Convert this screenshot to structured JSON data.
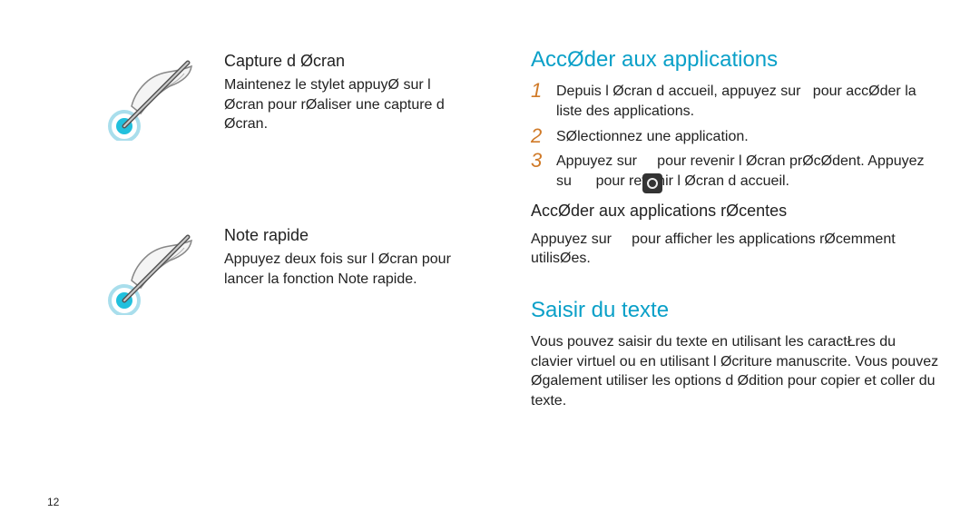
{
  "page_number": "12",
  "left": {
    "feature1": {
      "title": "Capture d Øcran",
      "body": "Maintenez le stylet appuyØ sur l Øcran pour rØaliser une capture d Øcran."
    },
    "feature2": {
      "title": "Note rapide",
      "body": "Appuyez deux fois sur l Øcran pour lancer la fonction Note rapide."
    }
  },
  "right": {
    "section1": {
      "title": "AccØder aux applications",
      "steps": [
        "Depuis l Øcran d accueil, appuyez sur   pour accØder   la liste des applications.",
        "SØlectionnez une application.",
        "Appuyez sur       pour revenir   l Øcran prØcØdent. Appuyez su      pour revenir   l Øcran d accueil."
      ],
      "sub_title": "AccØder aux applications rØcentes",
      "sub_body": "Appuyez sur       pour afficher les applications rØcemment utilisØes."
    },
    "section2": {
      "title": "Saisir du texte",
      "body": "Vous pouvez saisir du texte en utilisant les caractŁres du clavier virtuel ou en utilisant l Øcriture manuscrite. Vous pouvez Øgalement utiliser les options d Ødition pour copier et coller du texte."
    }
  }
}
